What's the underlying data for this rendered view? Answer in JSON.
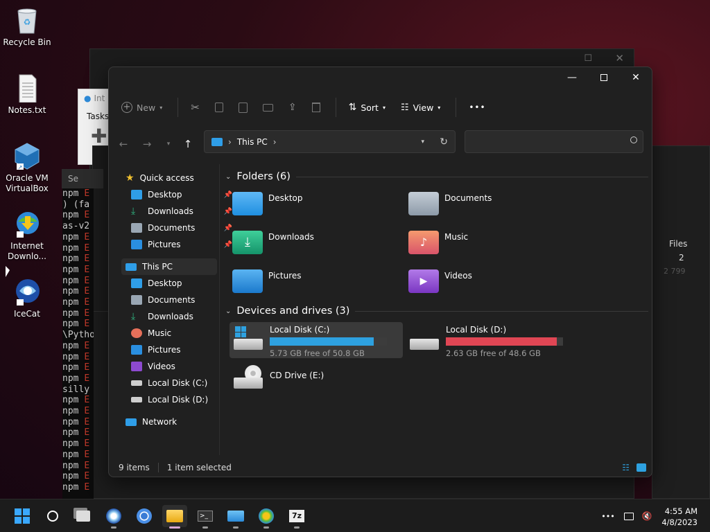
{
  "desktop": {
    "icons": [
      {
        "label": "Recycle Bin",
        "icon": "recycle-bin-icon"
      },
      {
        "label": "Notes.txt",
        "icon": "text-file-icon"
      },
      {
        "label": "Oracle VM VirtualBox",
        "icon": "virtualbox-icon"
      },
      {
        "label": "Internet Downlo...",
        "icon": "internet-download-manager-icon"
      },
      {
        "label": "IceCat",
        "icon": "icecat-icon"
      }
    ]
  },
  "background_windows": {
    "idm_tab": "Tasks",
    "idm_title": "Int",
    "terminal_title": "Se",
    "terminal_lines": [
      {
        "text": "npm ",
        "err": "E"
      },
      {
        "text": ") (fa",
        "err": ""
      },
      {
        "text": "npm ",
        "err": "E"
      },
      {
        "text": "as-v2",
        "err": ""
      },
      {
        "text": "npm ",
        "err": "E"
      },
      {
        "text": "npm ",
        "err": "E"
      },
      {
        "text": "npm ",
        "err": "E"
      },
      {
        "text": "npm ",
        "err": "E"
      },
      {
        "text": "npm ",
        "err": "E"
      },
      {
        "text": "npm ",
        "err": "E"
      },
      {
        "text": "npm ",
        "err": "E"
      },
      {
        "text": "npm ",
        "err": "E"
      },
      {
        "text": "npm ",
        "err": "E"
      },
      {
        "text": "\\Pytho",
        "err": ""
      },
      {
        "text": "npm ",
        "err": "E"
      },
      {
        "text": "npm ",
        "err": "E"
      },
      {
        "text": "npm ",
        "err": "E"
      },
      {
        "text": "npm ",
        "err": "E"
      },
      {
        "text": "silly",
        "err": ""
      },
      {
        "text": "npm ",
        "err": "E"
      },
      {
        "text": "npm ",
        "err": "E"
      },
      {
        "text": "npm ",
        "err": "E"
      },
      {
        "text": "npm ",
        "err": "E"
      },
      {
        "text": "npm ",
        "err": "E"
      },
      {
        "text": "npm ",
        "err": "E"
      },
      {
        "text": "npm ",
        "err": "E"
      },
      {
        "text": "npm ",
        "err": "E"
      },
      {
        "text": "npm ",
        "err": "E"
      }
    ],
    "table_header": "Files",
    "table_values": [
      "2",
      "2 799"
    ]
  },
  "explorer": {
    "toolbar": {
      "new_label": "New",
      "sort_label": "Sort",
      "view_label": "View",
      "more_label": "•••"
    },
    "address": {
      "location": "This PC"
    },
    "search": {
      "placeholder": ""
    },
    "sidebar": {
      "quick_access": "Quick access",
      "quick_items": [
        {
          "label": "Desktop",
          "icon": "desktop-folder-icon"
        },
        {
          "label": "Downloads",
          "icon": "downloads-folder-icon"
        },
        {
          "label": "Documents",
          "icon": "documents-folder-icon"
        },
        {
          "label": "Pictures",
          "icon": "pictures-folder-icon"
        }
      ],
      "this_pc": "This PC",
      "pc_items": [
        {
          "label": "Desktop",
          "icon": "desktop-folder-icon"
        },
        {
          "label": "Documents",
          "icon": "documents-folder-icon"
        },
        {
          "label": "Downloads",
          "icon": "downloads-folder-icon"
        },
        {
          "label": "Music",
          "icon": "music-folder-icon"
        },
        {
          "label": "Pictures",
          "icon": "pictures-folder-icon"
        },
        {
          "label": "Videos",
          "icon": "videos-folder-icon"
        },
        {
          "label": "Local Disk (C:)",
          "icon": "drive-icon"
        },
        {
          "label": "Local Disk (D:)",
          "icon": "drive-icon"
        }
      ],
      "network": "Network"
    },
    "folders_header": "Folders (6)",
    "folders": [
      {
        "label": "Desktop",
        "color": "#1f8fe0"
      },
      {
        "label": "Documents",
        "color": "#9aa7b4"
      },
      {
        "label": "Downloads",
        "color": "#1fa37a"
      },
      {
        "label": "Music",
        "color": "#e6705a"
      },
      {
        "label": "Pictures",
        "color": "#2a8fe0"
      },
      {
        "label": "Videos",
        "color": "#8d4ad0"
      }
    ],
    "drives_header": "Devices and drives (3)",
    "drives": [
      {
        "label": "Local Disk (C:)",
        "free": "5.73 GB free of 50.8 GB",
        "used_fraction": 0.887,
        "color": "#2ea1e0"
      },
      {
        "label": "Local Disk (D:)",
        "free": "2.63 GB free of 48.6 GB",
        "used_fraction": 0.946,
        "color": "#e04654"
      },
      {
        "label": "CD Drive (E:)",
        "free": "",
        "used_fraction": null,
        "color": ""
      }
    ],
    "status": {
      "items": "9 items",
      "selected": "1 item selected"
    }
  },
  "taskbar": {
    "apps": [
      "start-icon",
      "search-icon",
      "task-view-icon",
      "icecat-icon",
      "chromium-icon",
      "file-explorer-icon",
      "terminal-icon",
      "control-panel-icon",
      "internet-download-manager-icon",
      "7zip-icon"
    ],
    "time": "4:55 AM",
    "date": "4/8/2023",
    "overflow": "•••"
  }
}
